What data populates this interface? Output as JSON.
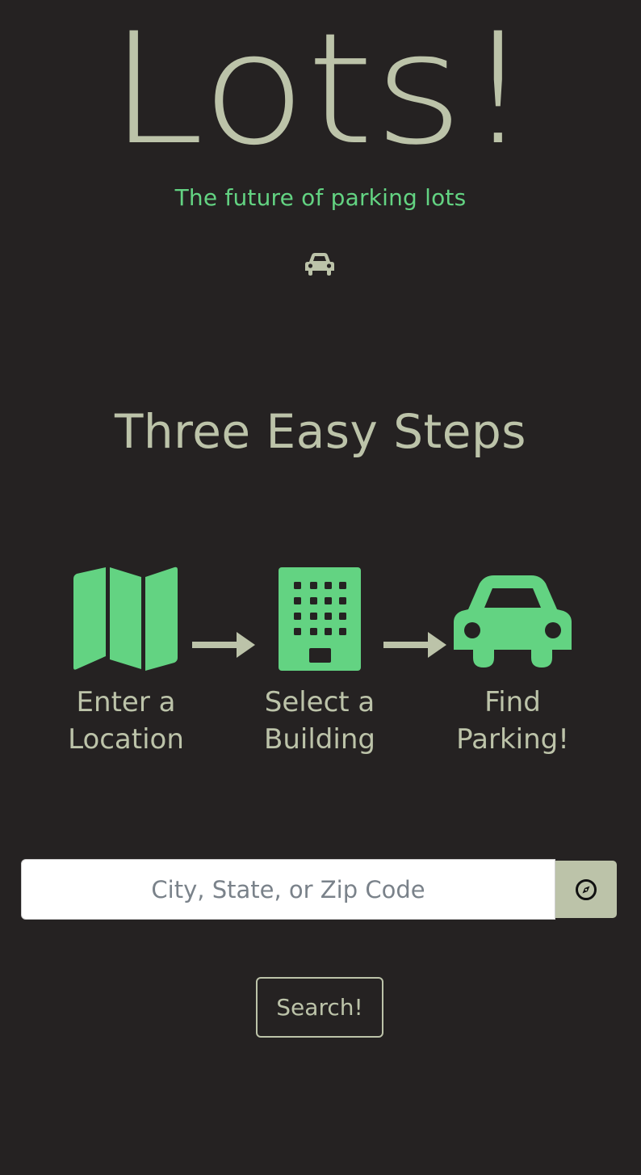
{
  "header": {
    "logo_text": "Lots!",
    "tagline": "The future of parking lots",
    "hero_icon": "car-icon"
  },
  "steps_section": {
    "title": "Three Easy Steps",
    "steps": [
      {
        "icon": "map-icon",
        "line1": "Enter a",
        "line2": "Location"
      },
      {
        "icon": "building-icon",
        "line1": "Select a",
        "line2": "Building"
      },
      {
        "icon": "car-icon",
        "line1": "Find",
        "line2": "Parking!"
      }
    ]
  },
  "search": {
    "placeholder": "City, State, or Zip Code",
    "value": "",
    "locate_icon": "compass-icon",
    "button_label": "Search!"
  },
  "colors": {
    "background": "#252222",
    "accent_green": "#63d382",
    "sage": "#bcc3a9"
  }
}
